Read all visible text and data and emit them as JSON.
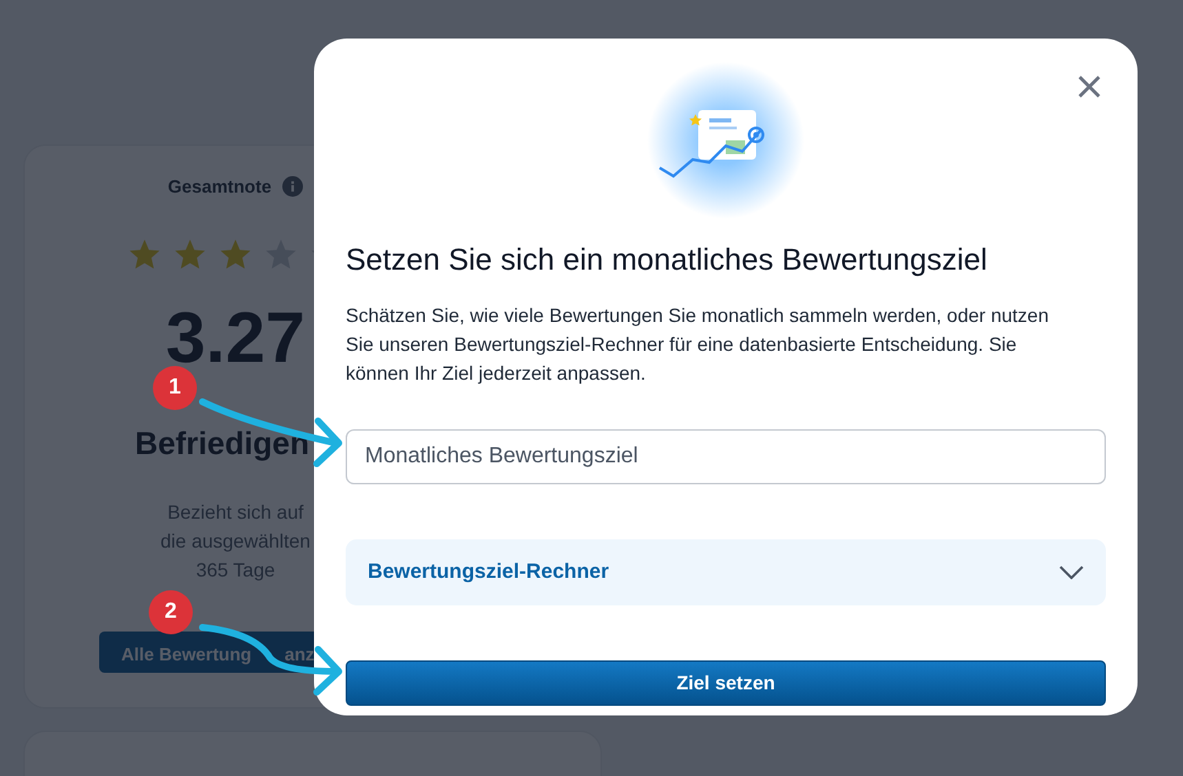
{
  "background": {
    "rating_card": {
      "title": "Gesamtnote",
      "stars": 3,
      "score": "3.27",
      "verdict": "Befriedigen",
      "note_lines": [
        "Bezieht sich auf",
        "die ausgewählten",
        "365 Tage"
      ],
      "button_parts": [
        "Alle Bewertung",
        "anz"
      ]
    }
  },
  "dialog": {
    "title": "Setzen Sie sich ein monatliches Bewertungsziel",
    "description": "Schätzen Sie, wie viele Bewertungen Sie monatlich sammeln werden, oder nutzen Sie unseren Bewertungsziel-Rechner für eine datenbasierte Entscheidung. Sie können Ihr Ziel jederzeit anpassen.",
    "goal_field": {
      "placeholder": "Monatliches Bewertungsziel"
    },
    "calculator": {
      "label": "Bewertungsziel-Rechner",
      "expanded": false
    },
    "submit_button": "Ziel setzen"
  },
  "annotations": [
    {
      "number": "1"
    },
    {
      "number": "2"
    }
  ]
}
